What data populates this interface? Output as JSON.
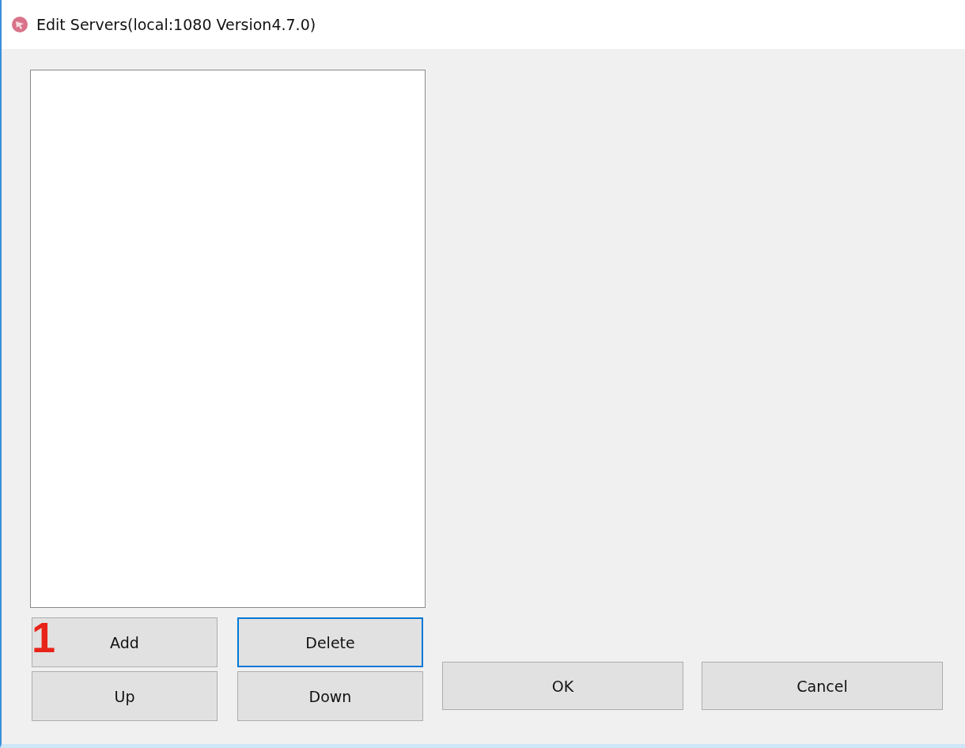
{
  "window": {
    "title": "Edit Servers(local:1080 Version4.7.0)"
  },
  "annotation": "1",
  "list_buttons": [
    {
      "label": "Add",
      "focused": false
    },
    {
      "label": "Delete",
      "focused": true
    },
    {
      "label": "Up",
      "focused": false
    },
    {
      "label": "Down",
      "focused": false
    }
  ],
  "dialog_buttons": [
    {
      "label": "OK",
      "focused": false
    },
    {
      "label": "Cancel",
      "focused": false
    }
  ]
}
